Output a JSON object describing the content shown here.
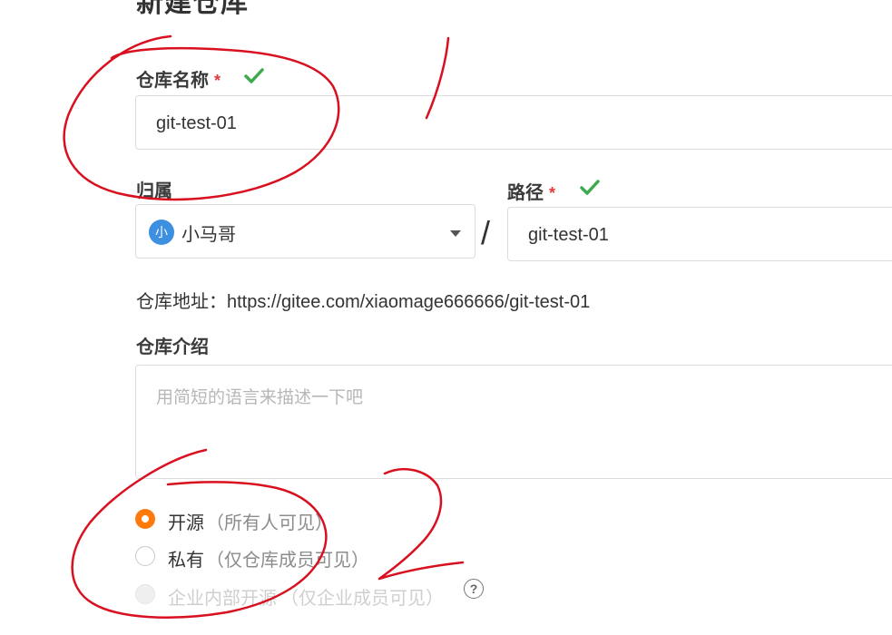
{
  "page": {
    "title": "新建仓库"
  },
  "repo_name": {
    "label": "仓库名称",
    "required_mark": "*",
    "value": "git-test-01"
  },
  "owner": {
    "label": "归属",
    "avatar_text": "小",
    "value": "小马哥"
  },
  "separator": "/",
  "path": {
    "label": "路径",
    "required_mark": "*",
    "value": "git-test-01"
  },
  "repo_url": {
    "label": "仓库地址：",
    "value": "https://gitee.com/xiaomage666666/git-test-01"
  },
  "description": {
    "label": "仓库介绍",
    "placeholder": "用简短的语言来描述一下吧"
  },
  "visibility": {
    "options": [
      {
        "label": "开源",
        "hint": "（所有人可见）",
        "selected": true,
        "disabled": false
      },
      {
        "label": "私有",
        "hint": "（仅仓库成员可见）",
        "selected": false,
        "disabled": false
      },
      {
        "label": "企业内部开源",
        "hint": "（仅企业成员可见）",
        "selected": false,
        "disabled": true
      }
    ],
    "help_icon": "?"
  },
  "colors": {
    "accent": "#ff7a0b",
    "valid": "#3daa4f",
    "required": "#e03a3a",
    "annotation": "#d8101f"
  }
}
